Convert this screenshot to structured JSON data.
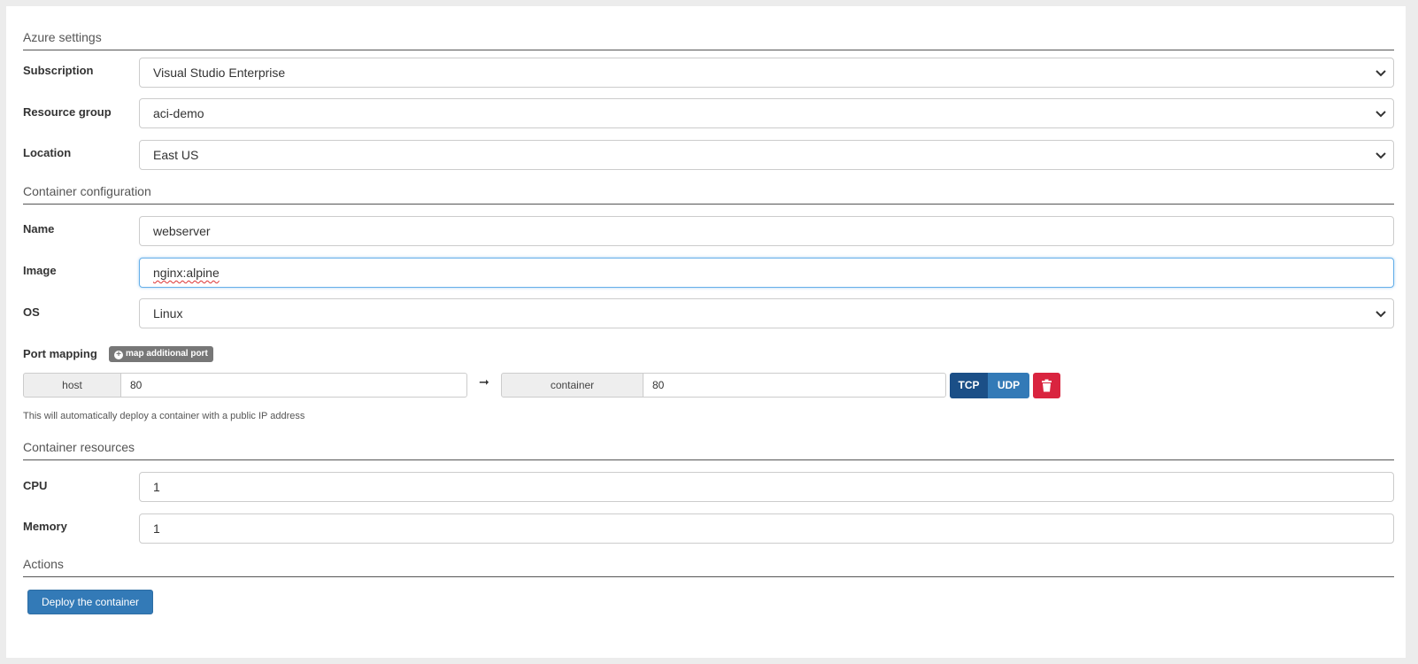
{
  "sections": {
    "azure": "Azure settings",
    "container_config": "Container configuration",
    "resources": "Container resources",
    "actions": "Actions"
  },
  "azure": {
    "subscription": {
      "label": "Subscription",
      "value": "Visual Studio Enterprise"
    },
    "resource_group": {
      "label": "Resource group",
      "value": "aci-demo"
    },
    "location": {
      "label": "Location",
      "value": "East US"
    }
  },
  "container": {
    "name": {
      "label": "Name",
      "value": "webserver"
    },
    "image": {
      "label": "Image",
      "value": "nginx:alpine"
    },
    "os": {
      "label": "OS",
      "value": "Linux"
    }
  },
  "ports": {
    "label": "Port mapping",
    "add_label": "map additional port",
    "host_label": "host",
    "host_value": "80",
    "arrow": "➞",
    "container_label": "container",
    "container_value": "80",
    "tcp": "TCP",
    "udp": "UDP",
    "help": "This will automatically deploy a container with a public IP address"
  },
  "resources": {
    "cpu": {
      "label": "CPU",
      "value": "1"
    },
    "memory": {
      "label": "Memory",
      "value": "1"
    }
  },
  "actions": {
    "deploy": "Deploy the container"
  },
  "colors": {
    "primary": "#337ab7",
    "primary_active": "#1b4f87",
    "danger": "#d9243f",
    "badge": "#777777"
  },
  "icons": {
    "select": "chevron-down-icon",
    "add": "plus-circle-icon",
    "delete": "trash-icon"
  }
}
